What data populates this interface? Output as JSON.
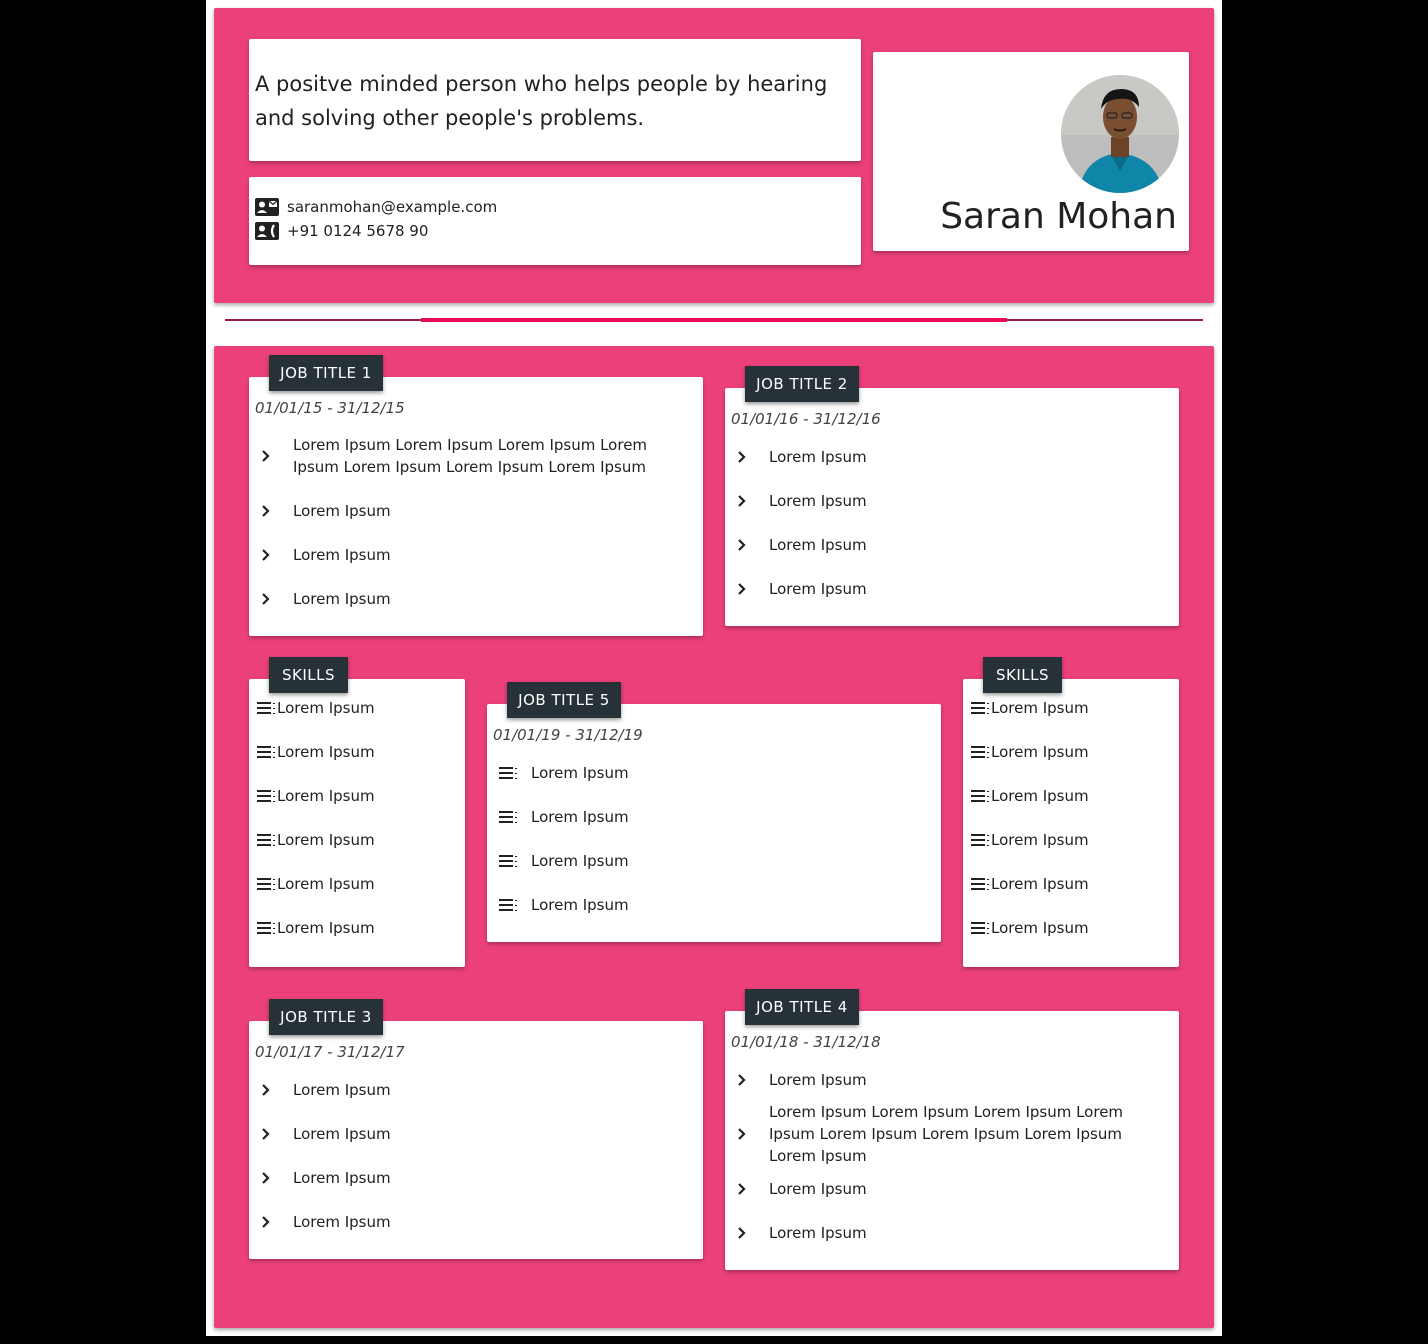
{
  "profile": {
    "about": "A positve minded person who helps people by hearing and solving other people's problems.",
    "email": "saranmohan@example.com",
    "phone": "+91 0124 5678 90",
    "name": "Saran Mohan"
  },
  "colors": {
    "panel": "#ec407a",
    "tag": "#263238",
    "divider": "#ec0a54"
  },
  "jobs": [
    {
      "title": "JOB TITLE 1",
      "dates": "01/01/15 - 31/12/15",
      "items": [
        "Lorem Ipsum Lorem Ipsum Lorem Ipsum Lorem Ipsum Lorem Ipsum Lorem Ipsum Lorem Ipsum",
        "Lorem Ipsum",
        "Lorem Ipsum",
        "Lorem Ipsum"
      ]
    },
    {
      "title": "JOB TITLE 2",
      "dates": "01/01/16 - 31/12/16",
      "items": [
        "Lorem Ipsum",
        "Lorem Ipsum",
        "Lorem Ipsum",
        "Lorem Ipsum"
      ]
    },
    {
      "title": "JOB TITLE 5",
      "dates": "01/01/19 - 31/12/19",
      "items": [
        "Lorem Ipsum",
        "Lorem Ipsum",
        "Lorem Ipsum",
        "Lorem Ipsum"
      ]
    },
    {
      "title": "JOB TITLE 3",
      "dates": "01/01/17 - 31/12/17",
      "items": [
        "Lorem Ipsum",
        "Lorem Ipsum",
        "Lorem Ipsum",
        "Lorem Ipsum"
      ]
    },
    {
      "title": "JOB TITLE 4",
      "dates": "01/01/18 - 31/12/18",
      "items": [
        "Lorem Ipsum",
        "Lorem Ipsum Lorem Ipsum Lorem Ipsum Lorem Ipsum Lorem Ipsum Lorem Ipsum Lorem Ipsum Lorem Ipsum",
        "Lorem Ipsum",
        "Lorem Ipsum"
      ]
    }
  ],
  "skills_left": {
    "title": "SKILLS",
    "items": [
      "Lorem Ipsum",
      "Lorem Ipsum",
      "Lorem Ipsum",
      "Lorem Ipsum",
      "Lorem Ipsum",
      "Lorem Ipsum"
    ]
  },
  "skills_right": {
    "title": "SKILLS",
    "items": [
      "Lorem Ipsum",
      "Lorem Ipsum",
      "Lorem Ipsum",
      "Lorem Ipsum",
      "Lorem Ipsum",
      "Lorem Ipsum"
    ]
  },
  "icons": {
    "email": "contact-mail-icon",
    "phone": "contact-phone-icon",
    "bullet": "chevron-right-icon",
    "skill": "list-lines-icon"
  }
}
